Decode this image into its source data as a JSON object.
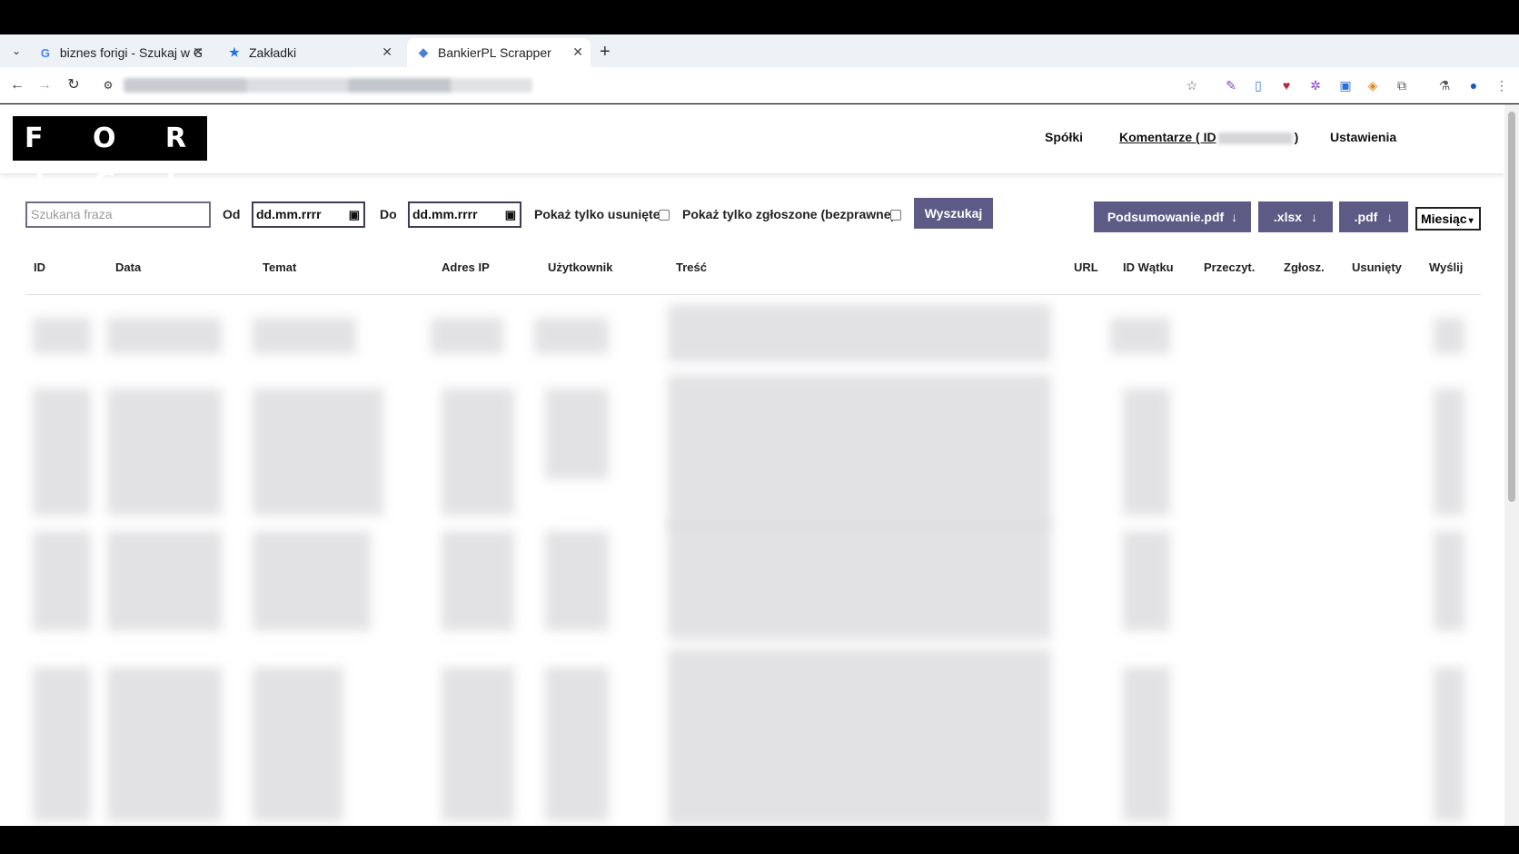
{
  "browser": {
    "tabs": [
      {
        "title": "biznes forigi - Szukaj w G",
        "icon": "google-g-icon"
      },
      {
        "title": "Zakładki",
        "icon": "star-icon"
      },
      {
        "title": "BankierPL Scrapper",
        "icon": "page-icon"
      }
    ],
    "new_tab": "+"
  },
  "header": {
    "logo": "F O R I G I",
    "nav": [
      {
        "label": "Spółki"
      },
      {
        "label_prefix": "Komentarze ( ID",
        "label_suffix": ")"
      },
      {
        "label": "Ustawienia"
      }
    ]
  },
  "filters": {
    "search_placeholder": "Szukana fraza",
    "from_label": "Od",
    "from_value": "dd.mm.rrrr",
    "to_label": "Do",
    "to_value": "dd.mm.rrrr",
    "deleted_only": "Pokaż tylko usunięte",
    "reported_only": "Pokaż tylko zgłoszone (bezprawne)",
    "search_button": "Wyszukaj"
  },
  "exports": {
    "summary_pdf": "Podsumowanie.pdf",
    "xlsx": ".xlsx",
    "pdf": ".pdf",
    "period": "Miesiąc"
  },
  "table": {
    "columns": [
      "ID",
      "Data",
      "Temat",
      "Adres IP",
      "Użytkownik",
      "Treść",
      "URL",
      "ID Wątku",
      "Przeczyt.",
      "Zgłosz.",
      "Usunięty",
      "Wyślij"
    ]
  },
  "colors": {
    "button": "#5e5a86",
    "logo_bg": "#000000"
  }
}
